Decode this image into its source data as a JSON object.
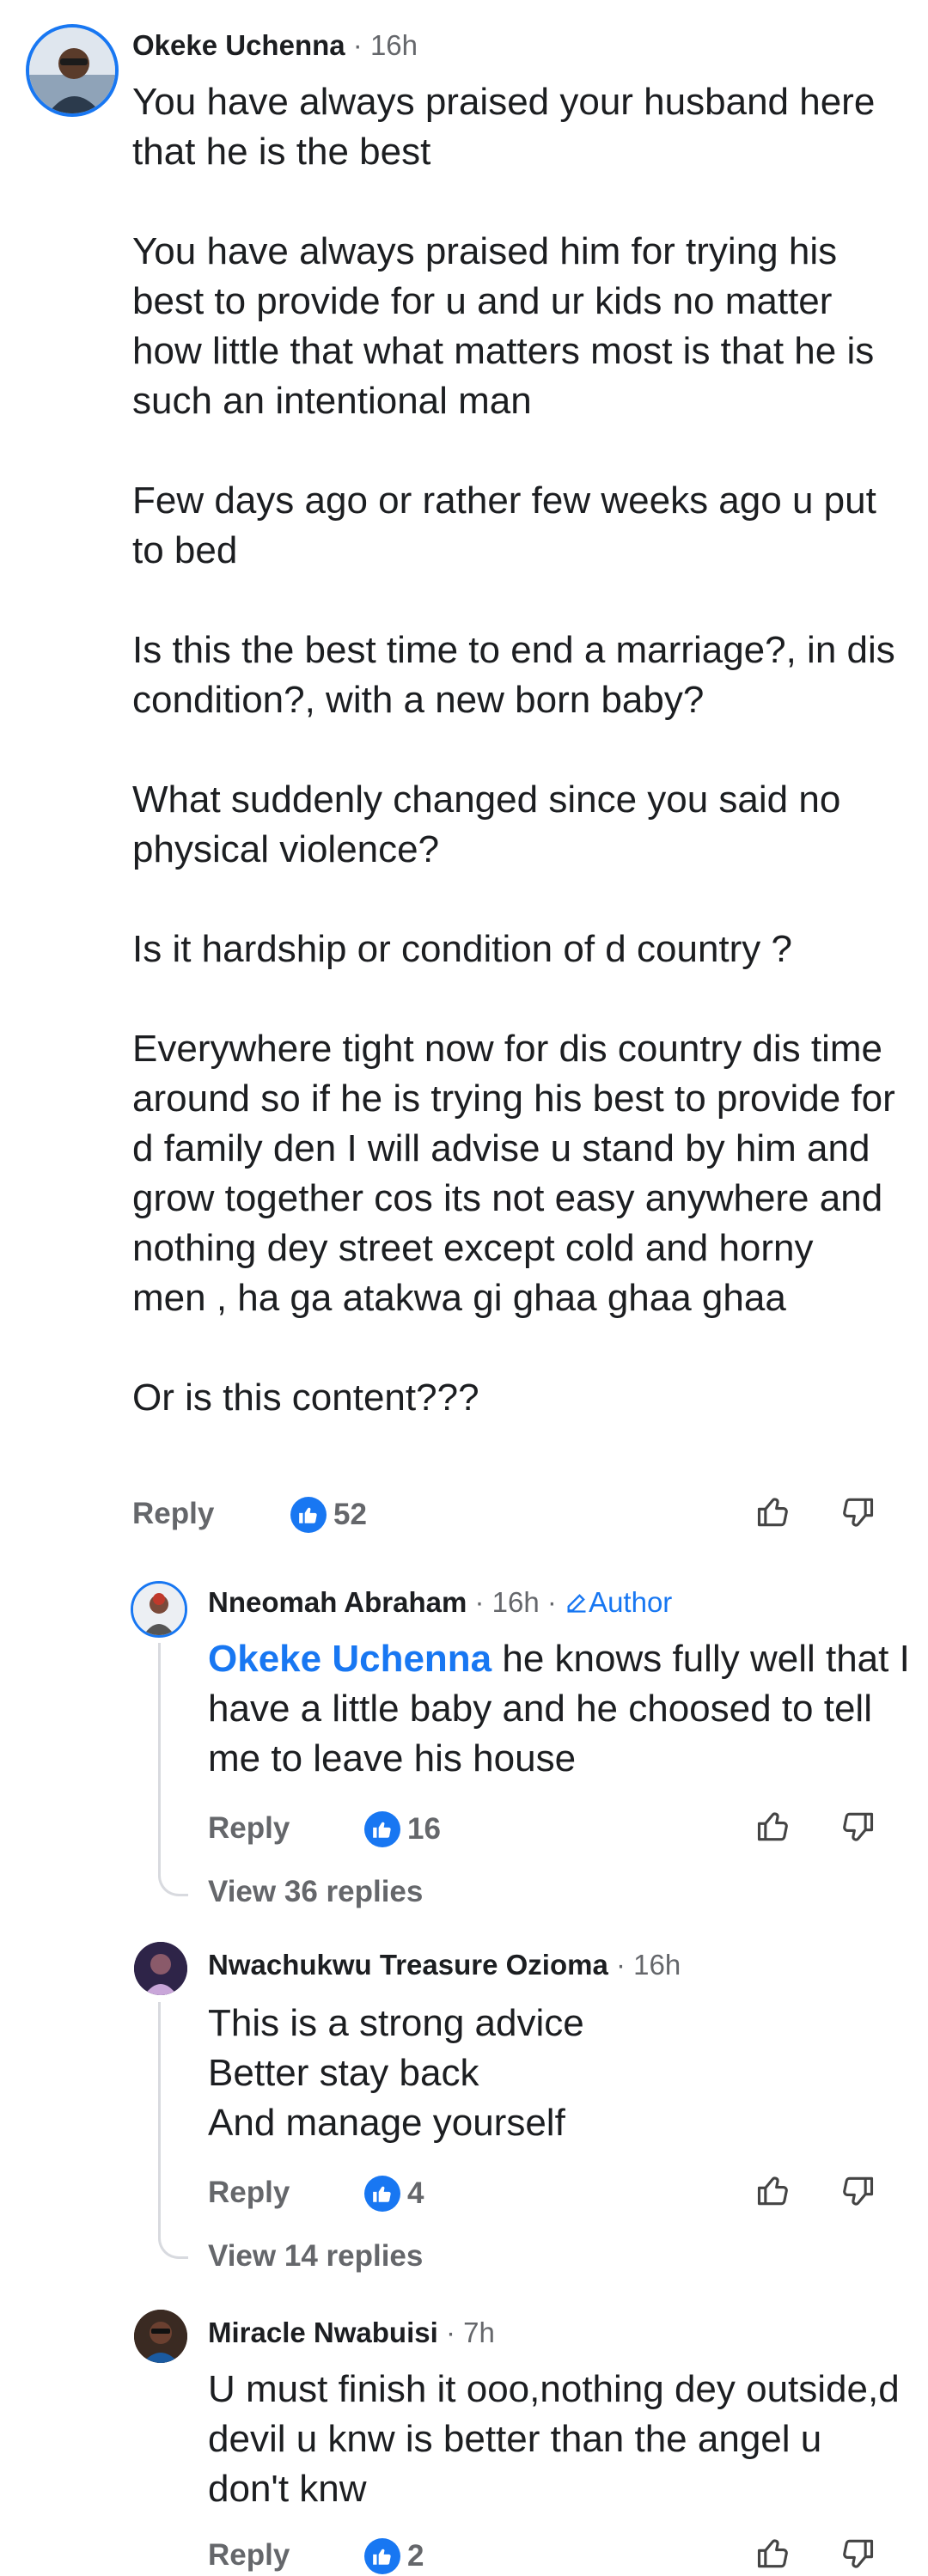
{
  "comment1": {
    "author": "Okeke Uchenna",
    "time": "· 16h",
    "paragraphs": [
      "You have always praised your husband here that he is the best",
      "You have always praised him for trying his best to provide for u and ur kids no matter how little that what matters most is that he is such an intentional man",
      "Few days ago or rather few weeks ago u put to bed",
      "Is this the best time to end a marriage?, in dis condition?, with a new born baby?",
      "What suddenly changed since you said no physical violence?",
      "Is it hardship or condition of d country ?",
      "Everywhere tight now for dis country dis time around so if he is trying his best to provide for d family den I will advise u stand by him and grow together cos its not easy anywhere and nothing dey street except cold and horny men , ha ga atakwa gi ghaa ghaa ghaa",
      "Or is this content???"
    ],
    "reply_label": "Reply",
    "likes": "52"
  },
  "reply1": {
    "author": "Nneomah Abraham",
    "time": "· 16h ·",
    "author_badge": "Author",
    "mention": "Okeke Uchenna",
    "text": " he knows fully well that I have a little baby and he choosed to tell me to leave his house",
    "reply_label": "Reply",
    "likes": "16",
    "view_replies": "View 36 replies"
  },
  "reply2": {
    "author": "Nwachukwu Treasure Ozioma",
    "time": "· 16h",
    "lines": [
      "This is a strong advice",
      "Better stay back",
      "And manage yourself"
    ],
    "reply_label": "Reply",
    "likes": "4",
    "view_replies": "View 14 replies"
  },
  "reply3": {
    "author": "Miracle Nwabuisi",
    "time": "· 7h",
    "text": "U must finish it ooo,nothing dey outside,d devil u knw is better than the angel u don't knw",
    "reply_label": "Reply",
    "likes": "2"
  },
  "icons": {
    "like": "thumbs-up-icon",
    "dislike": "thumbs-down-icon",
    "author_badge": "pencil-icon"
  },
  "colors": {
    "accent": "#1877f2",
    "muted": "#65676b",
    "text": "#1c1e21"
  }
}
